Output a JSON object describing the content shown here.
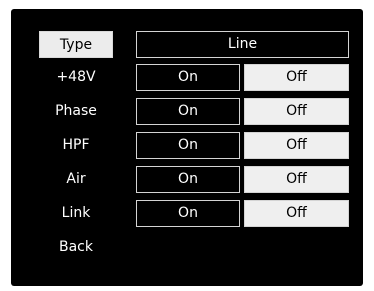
{
  "menu": {
    "type": {
      "label": "Type",
      "value": "Line"
    },
    "rows": [
      {
        "label": "+48V",
        "on": "On",
        "off": "Off",
        "state": "off"
      },
      {
        "label": "Phase",
        "on": "On",
        "off": "Off",
        "state": "off"
      },
      {
        "label": "HPF",
        "on": "On",
        "off": "Off",
        "state": "off"
      },
      {
        "label": "Air",
        "on": "On",
        "off": "Off",
        "state": "off"
      },
      {
        "label": "Link",
        "on": "On",
        "off": "Off",
        "state": "off"
      }
    ],
    "back": {
      "label": "Back"
    }
  },
  "colors": {
    "screen": "#000000",
    "selected_bg": "#ececec",
    "active_bg": "#efefef",
    "border": "#d4d4d4"
  }
}
